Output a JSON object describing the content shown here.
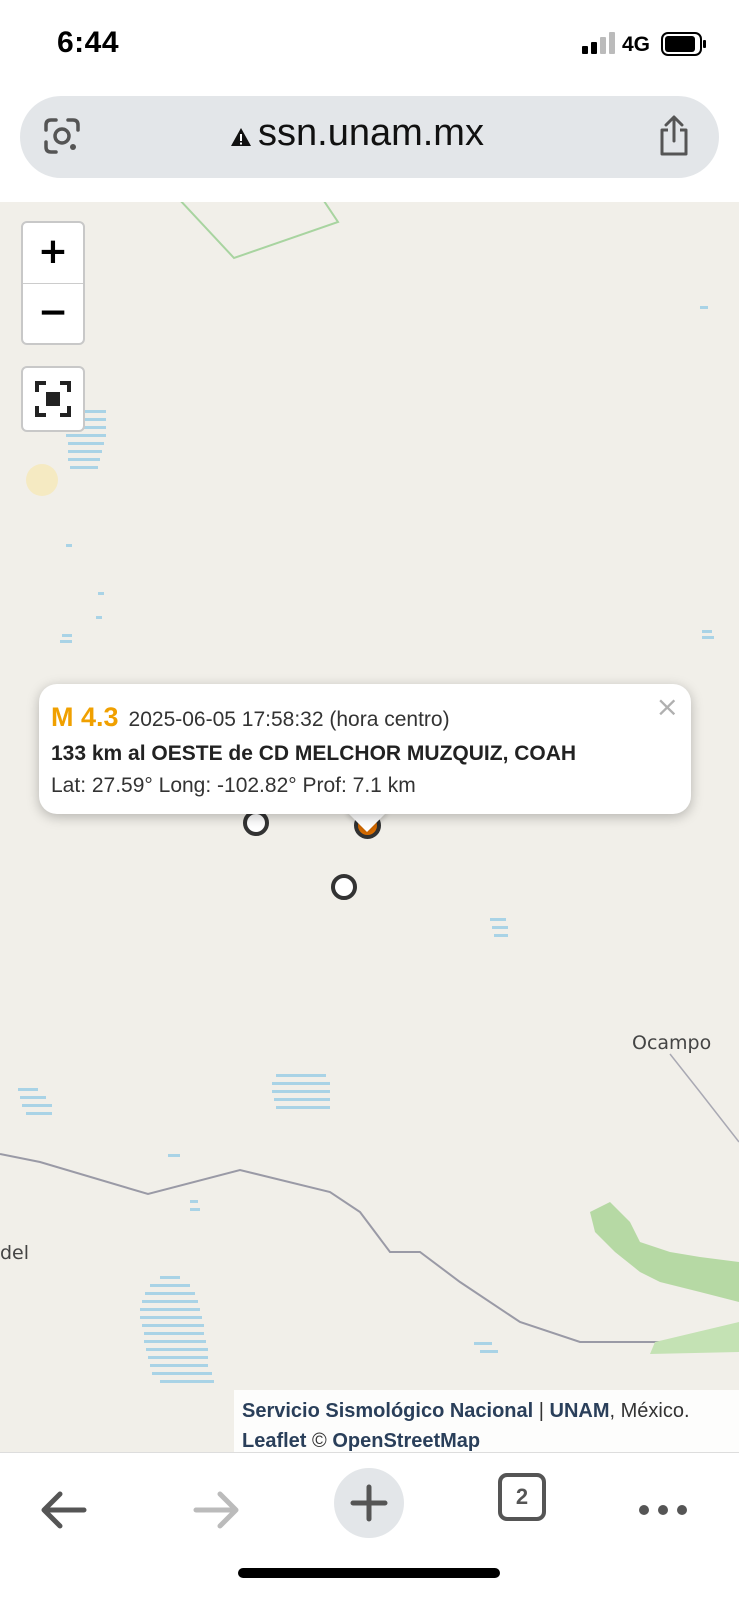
{
  "status": {
    "time": "6:44",
    "network": "4G"
  },
  "browser": {
    "url": "ssn.unam.mx",
    "tab_count": "2"
  },
  "map": {
    "zoom_in": "+",
    "zoom_out": "−",
    "places": [
      "Ocampo",
      "del"
    ],
    "attribution": {
      "ssn": "Servicio Sismológico Nacional",
      "sep": " | ",
      "unam": "UNAM",
      "country": ", México.",
      "leaflet": "Leaflet",
      "copy": " © ",
      "osm": "OpenStreetMap"
    }
  },
  "popup": {
    "magnitude": "M 4.3",
    "datetime": "2025-06-05  17:58:32 (hora centro)",
    "location": "133 km al OESTE de CD MELCHOR MUZQUIZ, COAH",
    "coords": "Lat: 27.59°  Long: -102.82°  Prof: 7.1 km",
    "close": "×"
  },
  "colors": {
    "magnitude": "#f0a000",
    "selected_marker": "#e07000",
    "map_bg": "#f1efe9"
  }
}
